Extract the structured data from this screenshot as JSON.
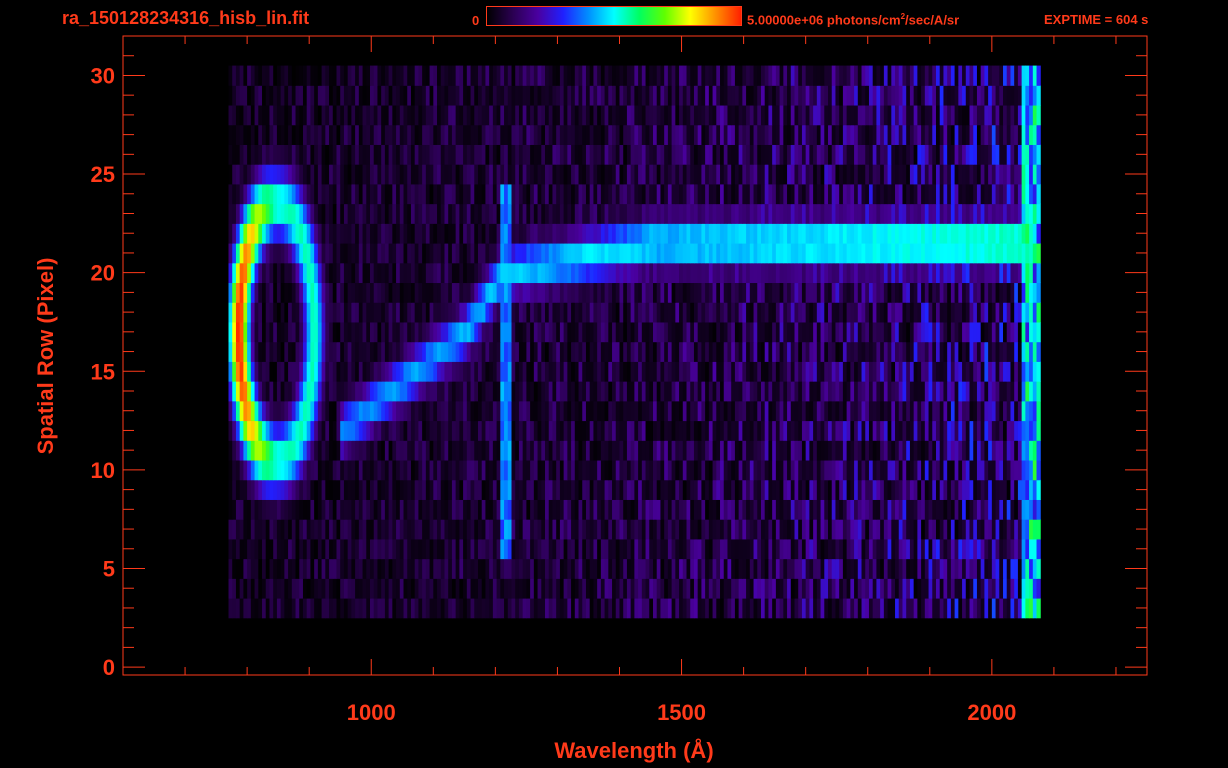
{
  "header": {
    "filename": "ra_150128234316_hisb_lin.fit",
    "colorbar_min": "0",
    "colorbar_max_value": "5.00000e+06",
    "colorbar_units_pre": " photons/cm",
    "colorbar_units_exp": "2",
    "colorbar_units_post": "/sec/A/sr",
    "exptime": "EXPTIME = 604 s"
  },
  "colors": {
    "axis": "#ff3a1a",
    "background": "#000000",
    "colormap": [
      "#000000",
      "#2a0050",
      "#4a00a0",
      "#2020ff",
      "#0090ff",
      "#00ffff",
      "#00ff60",
      "#60ff00",
      "#ffff00",
      "#ff9000",
      "#ff2000"
    ]
  },
  "chart_data": {
    "type": "heatmap",
    "title": "ra_150128234316_hisb_lin.fit",
    "xlabel": "Wavelength (Å)",
    "ylabel": "Spatial Row (Pixel)",
    "xlim": [
      600,
      2250
    ],
    "ylim": [
      -0.4,
      32
    ],
    "xticks": [
      1000,
      1500,
      2000
    ],
    "xtick_labels": [
      "1000",
      "1500",
      "2000"
    ],
    "yticks": [
      0,
      5,
      10,
      15,
      20,
      25,
      30
    ],
    "ytick_labels": [
      "0",
      "5",
      "10",
      "15",
      "20",
      "25",
      "30"
    ],
    "colorbar_range": [
      0,
      5000000
    ],
    "data_extent": {
      "x": [
        770,
        2075
      ],
      "rows": [
        3,
        30
      ]
    },
    "features": [
      {
        "kind": "ring",
        "center_x": 845,
        "center_row": 17,
        "half_width_x": 60,
        "half_height_rows": 6.5,
        "peak_level": 1.0
      },
      {
        "kind": "arc",
        "points": [
          [
            950,
            12
          ],
          [
            1150,
            17
          ],
          [
            1210,
            20
          ],
          [
            1450,
            21.5
          ],
          [
            2060,
            21.5
          ]
        ],
        "peak_level": 0.6
      },
      {
        "kind": "vertical_line",
        "x": 1215,
        "rows": [
          6,
          24
        ],
        "peak_level": 0.45
      },
      {
        "kind": "edge_band",
        "x": 2065,
        "rows": [
          3,
          30
        ],
        "peak_level": 0.65
      }
    ]
  }
}
